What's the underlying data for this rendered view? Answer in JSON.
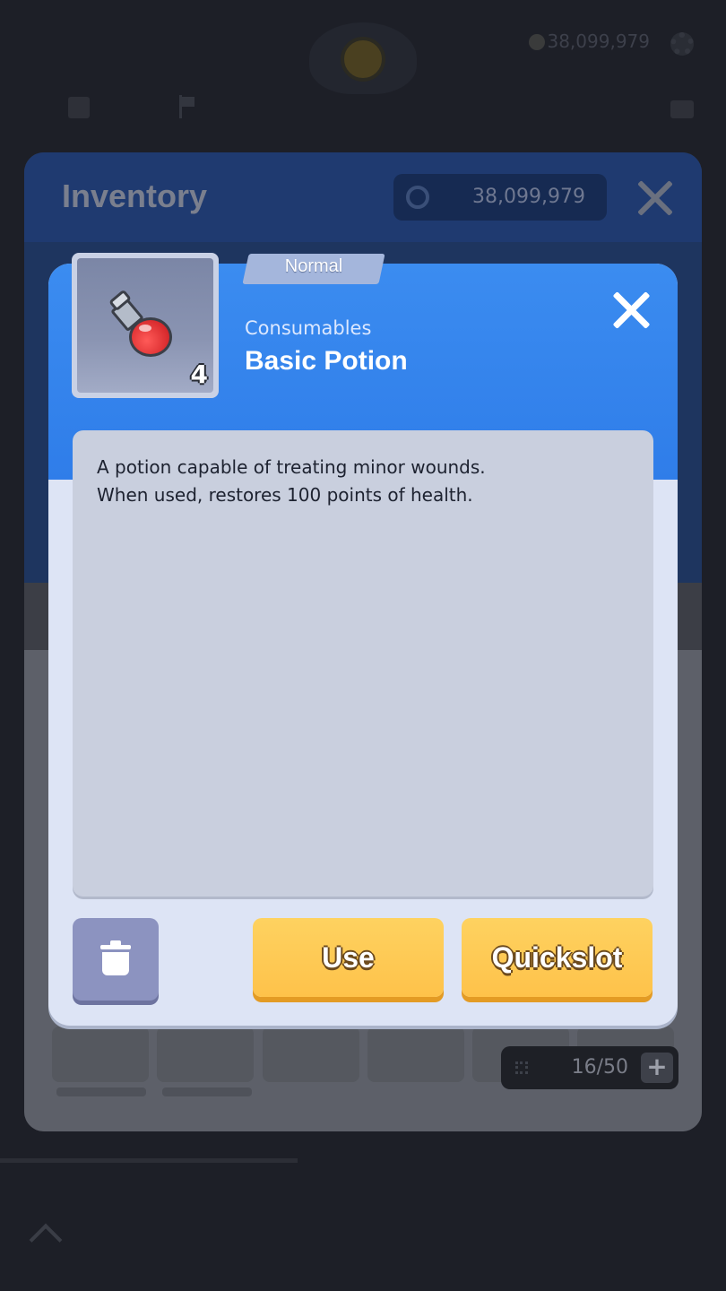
{
  "hud": {
    "currency": "38,099,979"
  },
  "inventory": {
    "title": "Inventory",
    "currency": "38,099,979",
    "capacity": "16/50",
    "capacity_add": "+"
  },
  "item_popup": {
    "rarity": "Normal",
    "category": "Consumables",
    "name": "Basic Potion",
    "count": "4",
    "description_lines": [
      "A potion capable of treating minor wounds.",
      "When used, restores 100 points of health."
    ],
    "buttons": {
      "delete_icon": "trash-icon",
      "use_label": "Use",
      "quickslot_label": "Quickslot"
    }
  },
  "colors": {
    "popup_header": "#2f7de9",
    "button_yellow": "#fec24a",
    "button_delete": "#8c93c0",
    "rarity_tag": "#a4b6dc"
  }
}
